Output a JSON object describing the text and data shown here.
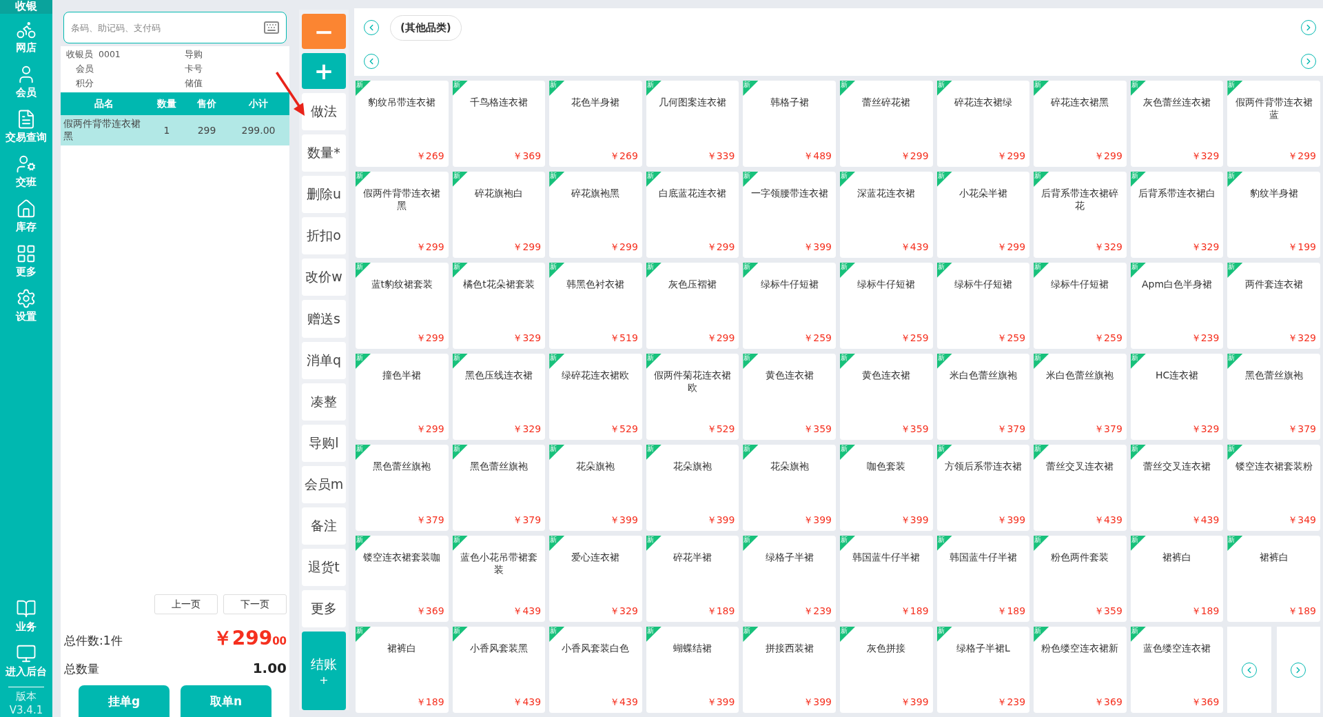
{
  "sidebar": {
    "title": "收银",
    "items": [
      {
        "label": "网店"
      },
      {
        "label": "会员"
      },
      {
        "label": "交易查询"
      },
      {
        "label": "交班"
      },
      {
        "label": "库存"
      },
      {
        "label": "更多"
      },
      {
        "label": "设置"
      }
    ],
    "bottom_items": [
      {
        "label": "业务"
      },
      {
        "label": "进入后台"
      }
    ],
    "version_label": "版本",
    "version": "V3.4.1"
  },
  "cart": {
    "search": {
      "placeholder": "条码、助记码、支付码"
    },
    "info": [
      {
        "label": "收银员",
        "value": "0001"
      },
      {
        "label": "导购"
      },
      {
        "label": "会员"
      },
      {
        "label": "卡号"
      },
      {
        "label": "积分"
      },
      {
        "label": "储值"
      }
    ],
    "columns": [
      "品名",
      "数量",
      "售价",
      "小计"
    ],
    "rows": [
      {
        "cells": [
          "假两件背带连衣裙黑",
          "1",
          "299",
          "299.00"
        ],
        "selected": true
      }
    ],
    "pager": [
      "上一页",
      "下一页"
    ],
    "total_count": "总件数:1件",
    "total_amount": "￥299",
    "total_cents": "00",
    "quantity_label": "总数量",
    "quantity": "1.00",
    "buttons": [
      "挂单g",
      "取单n"
    ]
  },
  "actions": [
    {
      "label": "−",
      "kind": "minus"
    },
    {
      "label": "+",
      "kind": "plus"
    },
    {
      "label": "做法",
      "kind": "plain"
    },
    {
      "label": "数量*",
      "kind": "plain"
    },
    {
      "label": "删除u",
      "kind": "plain"
    },
    {
      "label": "折扣o",
      "kind": "plain"
    },
    {
      "label": "改价w",
      "kind": "plain"
    },
    {
      "label": "赠送s",
      "kind": "plain"
    },
    {
      "label": "消单q",
      "kind": "plain"
    },
    {
      "label": "凑整",
      "kind": "plain"
    },
    {
      "label": "导购l",
      "kind": "plain"
    },
    {
      "label": "会员m",
      "kind": "plain"
    },
    {
      "label": "备注",
      "kind": "plain"
    },
    {
      "label": "退货t",
      "kind": "plain"
    },
    {
      "label": "更多",
      "kind": "plain"
    },
    {
      "label": "结账",
      "sub": "+",
      "kind": "checkout"
    }
  ],
  "categories": [
    {
      "label": "(其他品类)",
      "selected": false
    }
  ],
  "products": [
    {
      "name": "豹纹吊带连衣裙",
      "price": "￥269",
      "badge": "新"
    },
    {
      "name": "千鸟格连衣裙",
      "price": "￥369",
      "badge": "新"
    },
    {
      "name": "花色半身裙",
      "price": "￥269",
      "badge": "新"
    },
    {
      "name": "几何图案连衣裙",
      "price": "￥339",
      "badge": "新"
    },
    {
      "name": "韩格子裙",
      "price": "￥489",
      "badge": "新"
    },
    {
      "name": "蕾丝碎花裙",
      "price": "￥299",
      "badge": "新"
    },
    {
      "name": "碎花连衣裙绿",
      "price": "￥299",
      "badge": "新"
    },
    {
      "name": "碎花连衣裙黑",
      "price": "￥299",
      "badge": "新"
    },
    {
      "name": "灰色蕾丝连衣裙",
      "price": "￥329",
      "badge": "新"
    },
    {
      "name": "假两件背带连衣裙蓝",
      "price": "￥299",
      "badge": "新"
    },
    {
      "name": "假两件背带连衣裙黑",
      "price": "￥299",
      "badge": "新"
    },
    {
      "name": "碎花旗袍白",
      "price": "￥299",
      "badge": "新"
    },
    {
      "name": "碎花旗袍黑",
      "price": "￥299",
      "badge": "新"
    },
    {
      "name": "白底蓝花连衣裙",
      "price": "￥299",
      "badge": "新"
    },
    {
      "name": "一字领腰带连衣裙",
      "price": "￥399",
      "badge": "新"
    },
    {
      "name": "深蓝花连衣裙",
      "price": "￥439",
      "badge": "新"
    },
    {
      "name": "小花朵半裙",
      "price": "￥299",
      "badge": "新"
    },
    {
      "name": "后背系带连衣裙碎花",
      "price": "￥329",
      "badge": "新"
    },
    {
      "name": "后背系带连衣裙白",
      "price": "￥329",
      "badge": "新"
    },
    {
      "name": "豹纹半身裙",
      "price": "￥199",
      "badge": "新"
    },
    {
      "name": "蓝t豹纹裙套装",
      "price": "￥299",
      "badge": "新"
    },
    {
      "name": "橘色t花朵裙套装",
      "price": "￥329",
      "badge": "新"
    },
    {
      "name": "韩黑色衬衣裙",
      "price": "￥519",
      "badge": "新"
    },
    {
      "name": "灰色压褶裙",
      "price": "￥299",
      "badge": "新"
    },
    {
      "name": "绿标牛仔短裙",
      "price": "￥259",
      "badge": "新"
    },
    {
      "name": "绿标牛仔短裙",
      "price": "￥259",
      "badge": "新"
    },
    {
      "name": "绿标牛仔短裙",
      "price": "￥259",
      "badge": "新"
    },
    {
      "name": "绿标牛仔短裙",
      "price": "￥259",
      "badge": "新"
    },
    {
      "name": "Apm白色半身裙",
      "price": "￥239",
      "badge": "新"
    },
    {
      "name": "两件套连衣裙",
      "price": "￥329",
      "badge": "新"
    },
    {
      "name": "撞色半裙",
      "price": "￥299",
      "badge": "新"
    },
    {
      "name": "黑色压线连衣裙",
      "price": "￥329",
      "badge": "新"
    },
    {
      "name": "绿碎花连衣裙欧",
      "price": "￥529",
      "badge": "新"
    },
    {
      "name": "假两件菊花连衣裙欧",
      "price": "￥529",
      "badge": "新"
    },
    {
      "name": "黄色连衣裙",
      "price": "￥359",
      "badge": "新"
    },
    {
      "name": "黄色连衣裙",
      "price": "￥359",
      "badge": "新"
    },
    {
      "name": "米白色蕾丝旗袍",
      "price": "￥379",
      "badge": "新"
    },
    {
      "name": "米白色蕾丝旗袍",
      "price": "￥379",
      "badge": "新"
    },
    {
      "name": "HC连衣裙",
      "price": "￥329",
      "badge": "新"
    },
    {
      "name": "黑色蕾丝旗袍",
      "price": "￥379",
      "badge": "新"
    },
    {
      "name": "黑色蕾丝旗袍",
      "price": "￥379",
      "badge": "新"
    },
    {
      "name": "黑色蕾丝旗袍",
      "price": "￥379",
      "badge": "新"
    },
    {
      "name": "花朵旗袍",
      "price": "￥399",
      "badge": "新"
    },
    {
      "name": "花朵旗袍",
      "price": "￥399",
      "badge": "新"
    },
    {
      "name": "花朵旗袍",
      "price": "￥399",
      "badge": "新"
    },
    {
      "name": "咖色套装",
      "price": "￥399",
      "badge": "新"
    },
    {
      "name": "方领后系带连衣裙",
      "price": "￥399",
      "badge": "新"
    },
    {
      "name": "蕾丝交叉连衣裙",
      "price": "￥439",
      "badge": "新"
    },
    {
      "name": "蕾丝交叉连衣裙",
      "price": "￥439",
      "badge": "新"
    },
    {
      "name": "镂空连衣裙套装粉",
      "price": "￥349",
      "badge": "新"
    },
    {
      "name": "镂空连衣裙套装咖",
      "price": "￥369",
      "badge": "新"
    },
    {
      "name": "蓝色小花吊带裙套装",
      "price": "￥439",
      "badge": "新"
    },
    {
      "name": "爱心连衣裙",
      "price": "￥329",
      "badge": "新"
    },
    {
      "name": "碎花半裙",
      "price": "￥189",
      "badge": "新"
    },
    {
      "name": "绿格子半裙",
      "price": "￥239",
      "badge": "新"
    },
    {
      "name": "韩国蓝牛仔半裙",
      "price": "￥189",
      "badge": "新"
    },
    {
      "name": "韩国蓝牛仔半裙",
      "price": "￥189",
      "badge": "新"
    },
    {
      "name": "粉色两件套装",
      "price": "￥359",
      "badge": "新"
    },
    {
      "name": "裙裤白",
      "price": "￥189",
      "badge": "新"
    },
    {
      "name": "裙裤白",
      "price": "￥189",
      "badge": "新"
    },
    {
      "name": "裙裤白",
      "price": "￥189",
      "badge": "新"
    },
    {
      "name": "小香风套装黑",
      "price": "￥439",
      "badge": "新"
    },
    {
      "name": "小香风套装白色",
      "price": "￥439",
      "badge": "新"
    },
    {
      "name": "蝴蝶结裙",
      "price": "￥399",
      "badge": "新"
    },
    {
      "name": "拼接西装裙",
      "price": "￥399",
      "badge": "新"
    },
    {
      "name": "灰色拼接",
      "price": "￥399",
      "badge": "新"
    },
    {
      "name": "绿格子半裙L",
      "price": "￥239",
      "badge": "新"
    },
    {
      "name": "粉色缕空连衣裙新",
      "price": "￥369",
      "badge": "新"
    },
    {
      "name": "蓝色缕空连衣裙",
      "price": "￥369",
      "badge": "新"
    }
  ]
}
